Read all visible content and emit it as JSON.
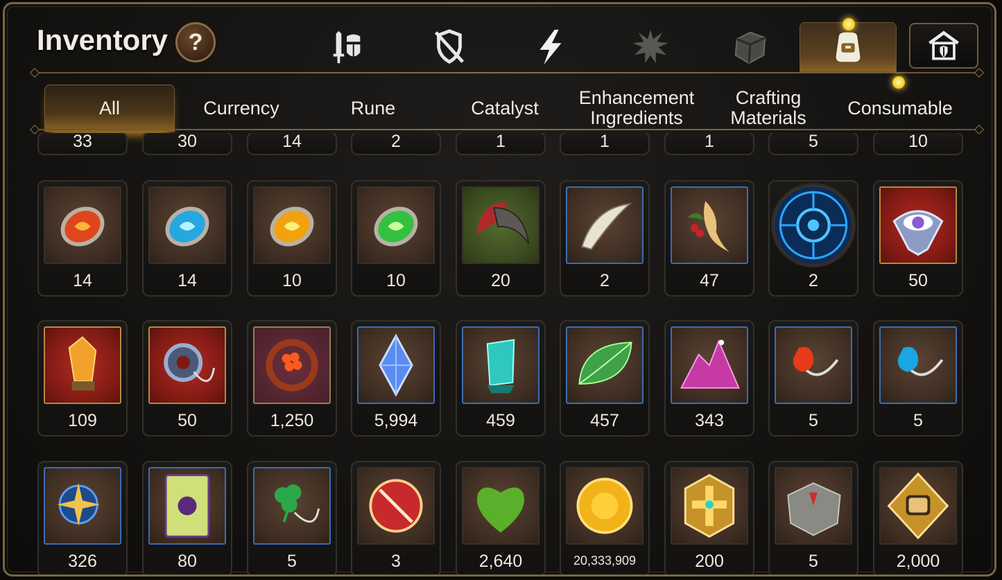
{
  "header": {
    "title": "Inventory",
    "help_label": "?"
  },
  "category_tabs": [
    {
      "icon": "armor-sword-icon",
      "active": false
    },
    {
      "icon": "broken-shield-icon",
      "active": false
    },
    {
      "icon": "lightning-icon",
      "active": false
    },
    {
      "icon": "burst-silhouette-icon",
      "active": false
    },
    {
      "icon": "box-icon",
      "active": false
    },
    {
      "icon": "backpack-icon",
      "active": true
    },
    {
      "icon": "guild-house-icon",
      "active": false
    }
  ],
  "sub_tabs": [
    {
      "label": "All",
      "active": true
    },
    {
      "label": "Currency",
      "active": false
    },
    {
      "label": "Rune",
      "active": false
    },
    {
      "label": "Catalyst",
      "active": false
    },
    {
      "label": "Enhancement\nIngredients",
      "active": false
    },
    {
      "label": "Crafting\nMaterials",
      "active": false
    },
    {
      "label": "Consumable",
      "active": false
    }
  ],
  "items": {
    "row0": [
      "33",
      "30",
      "14",
      "2",
      "1",
      "1",
      "1",
      "5",
      "10"
    ],
    "row1": [
      {
        "icon": "red-rune-stone-icon",
        "qty": "14"
      },
      {
        "icon": "blue-rune-stone-icon",
        "qty": "14"
      },
      {
        "icon": "yellow-rune-stone-icon",
        "qty": "10"
      },
      {
        "icon": "green-rune-stone-icon",
        "qty": "10"
      },
      {
        "icon": "claw-icon",
        "qty": "20"
      },
      {
        "icon": "fang-icon",
        "qty": "2"
      },
      {
        "icon": "herb-root-icon",
        "qty": "47"
      },
      {
        "icon": "blue-seal-icon",
        "qty": "2"
      },
      {
        "icon": "eye-emblem-icon",
        "qty": "50"
      }
    ],
    "row2": [
      {
        "icon": "orange-crystal-icon",
        "qty": "109"
      },
      {
        "icon": "ring-pendant-icon",
        "qty": "50"
      },
      {
        "icon": "flower-ring-icon",
        "qty": "1,250"
      },
      {
        "icon": "blue-gem-icon",
        "qty": "5,994"
      },
      {
        "icon": "teal-crystal-icon",
        "qty": "459"
      },
      {
        "icon": "green-leaf-icon",
        "qty": "457"
      },
      {
        "icon": "pink-ore-icon",
        "qty": "343"
      },
      {
        "icon": "fire-pendant-icon",
        "qty": "5"
      },
      {
        "icon": "water-pendant-icon",
        "qty": "5"
      }
    ],
    "row3": [
      {
        "icon": "star-pendant-icon",
        "qty": "326"
      },
      {
        "icon": "card-icon",
        "qty": "80"
      },
      {
        "icon": "clover-pendant-icon",
        "qty": "5"
      },
      {
        "icon": "badge-icon",
        "qty": "3"
      },
      {
        "icon": "green-heart-icon",
        "qty": "2,640"
      },
      {
        "icon": "gold-coin-icon",
        "qty": "20,333,909"
      },
      {
        "icon": "gold-emblem-icon",
        "qty": "200"
      },
      {
        "icon": "stone-cube-icon",
        "qty": "5"
      },
      {
        "icon": "fist-emblem-icon",
        "qty": "2,000"
      }
    ]
  },
  "colors": {
    "frame": "#7a6444",
    "accent_gold": "#c98c26",
    "text": "#efe9df"
  }
}
